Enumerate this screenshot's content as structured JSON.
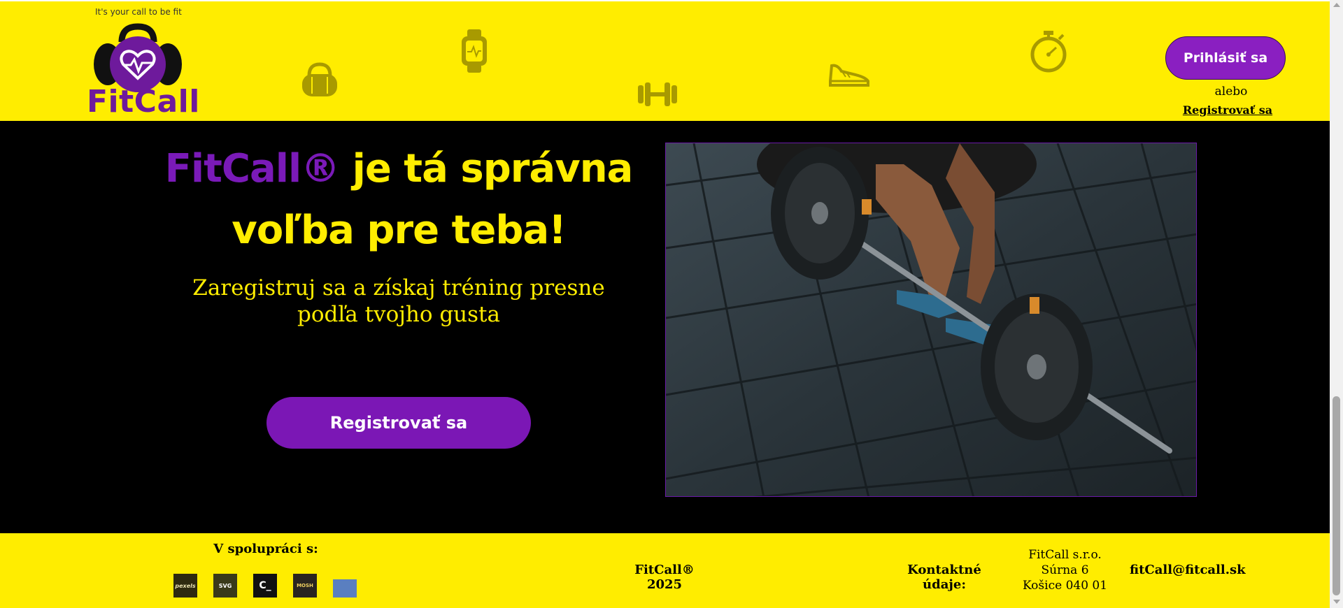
{
  "header": {
    "tagline": "It's your call to be fit",
    "logo_text": "FitCall",
    "login_label": "Prihlásiť sa",
    "or_text": "alebo",
    "register_link": "Registrovať sa"
  },
  "hero": {
    "title_brand": "FitCall®",
    "title_rest": " je tá správna voľba pre teba!",
    "subtitle": "Zaregistruj sa a získaj tréning presne podľa tvojho gusta",
    "cta_label": "Registrovať sa"
  },
  "footer": {
    "partners_title": "V spolupráci s:",
    "partners": [
      {
        "name": "pexels",
        "label": "pexels"
      },
      {
        "name": "svgrepo",
        "label": "SVG"
      },
      {
        "name": "codepen",
        "label": "C_"
      },
      {
        "name": "mosh",
        "label": "MOSH"
      },
      {
        "name": "unknown",
        "label": ""
      }
    ],
    "copyright": "FitCall® 2025",
    "contact_label": "Kontaktné údaje:",
    "address_lines": [
      "FitCall s.r.o.",
      "Súrna 6",
      "Košice 040 01"
    ],
    "email": "fitCall@fitcall.sk"
  },
  "icons": {
    "header_decor": [
      "gym-bag-icon",
      "smartwatch-icon",
      "dumbbell-icon",
      "sneaker-icon",
      "stopwatch-icon"
    ]
  },
  "colors": {
    "brand_yellow": "#ffed00",
    "brand_purple": "#7b17b5",
    "hero_background": "#000000"
  }
}
